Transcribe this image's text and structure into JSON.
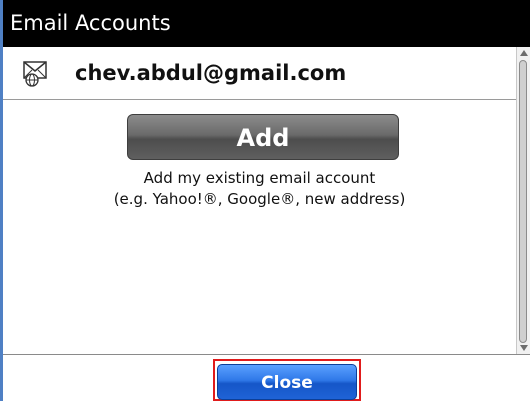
{
  "window": {
    "title": "Email Accounts"
  },
  "account": {
    "email": "chev.abdul@gmail.com",
    "icon": "envelope-globe-icon"
  },
  "add_section": {
    "button_label": "Add",
    "description_line1": "Add my existing email account",
    "description_line2": "(e.g. Yahoo!®, Google®, new address)"
  },
  "footer": {
    "close_label": "Close"
  },
  "colors": {
    "title_bar": "#000000",
    "close_button": "#2f78e8",
    "add_button": "#6a6a6a",
    "highlight": "#e01b1b",
    "frame": "#4f80c4"
  }
}
